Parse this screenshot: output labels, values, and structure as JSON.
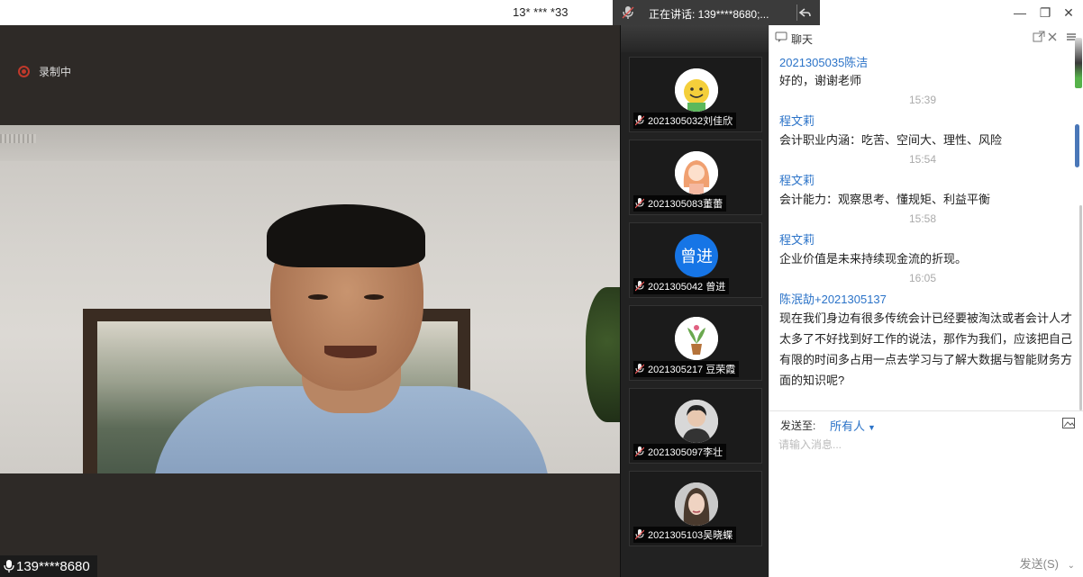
{
  "window": {
    "title": "13* *** *33",
    "speaking_text": "正在讲话: 139****8680;...",
    "min_glyph": "—",
    "max_glyph": "❐",
    "close_glyph": "✕"
  },
  "stage": {
    "recording_label": "录制中",
    "presenter_name": "139****8680"
  },
  "participants": [
    {
      "name": "2021305032刘佳欣",
      "avatar": "smiley-icon"
    },
    {
      "name": "2021305083董蕾",
      "avatar": "girl-icon"
    },
    {
      "name": "2021305042 曾进",
      "avatar": "text",
      "avatar_text": "曾进"
    },
    {
      "name": "2021305217 豆荣霞",
      "avatar": "plant-icon"
    },
    {
      "name": "2021305097李壮",
      "avatar": "man-icon"
    },
    {
      "name": "2021305103吴晓蝶",
      "avatar": "woman-icon"
    }
  ],
  "chat": {
    "title": "聊天",
    "messages": [
      {
        "sender": "2021305035陈洁",
        "text": "好的，谢谢老师",
        "time": "15:39"
      },
      {
        "sender": "程文莉",
        "text": "会计职业内涵：吃苦、空间大、理性、风险",
        "time": "15:54"
      },
      {
        "sender": "程文莉",
        "text": "会计能力：观察思考、懂规矩、利益平衡",
        "time": "15:58"
      },
      {
        "sender": "程文莉",
        "text": "企业价值是未来持续现金流的折现。",
        "time": "16:05"
      },
      {
        "sender": "陈泯劼+2021305137",
        "text": "现在我们身边有很多传统会计已经要被淘汰或者会计人才太多了不好找到好工作的说法，那作为我们，应该把自己有限的时间多占用一点去学习与了解大数据与智能财务方面的知识呢?"
      }
    ],
    "send_to_label": "发送至:",
    "recipient": "所有人",
    "input_placeholder": "请输入消息...",
    "send_label": "发送(S)"
  },
  "colors": {
    "accent": "#2b73c8",
    "record_red": "#c0392b",
    "stage_bg": "#2e2a27"
  }
}
